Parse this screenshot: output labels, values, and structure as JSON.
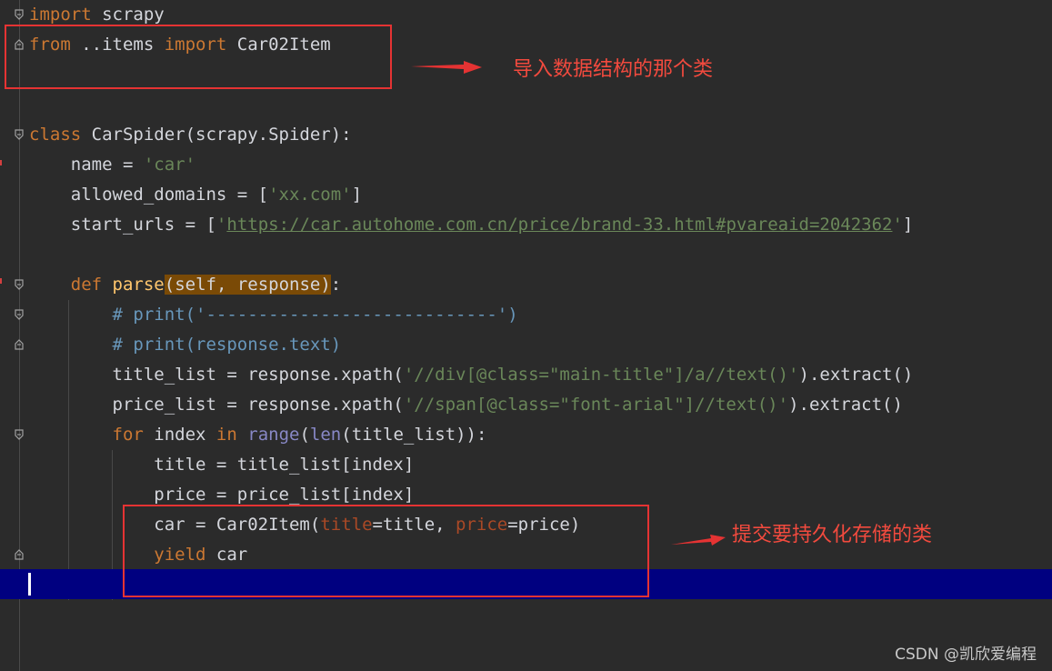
{
  "code": {
    "l1": {
      "kw_import": "import",
      "module": " scrapy"
    },
    "l2": {
      "kw_from": "from",
      "path": " ..items ",
      "kw_import": "import",
      "name": " Car02Item"
    },
    "l5": {
      "kw_class": "class",
      "name": " CarSpider(scrapy.Spider):"
    },
    "l6": {
      "indent": "    ",
      "attr": "name = ",
      "value": "'car'"
    },
    "l7": {
      "indent": "    ",
      "attr": "allowed_domains = [",
      "value": "'xx.com'",
      "close": "]"
    },
    "l8": {
      "indent": "    ",
      "attr": "start_urls = [",
      "q1": "'",
      "url": "https://car.autohome.com.cn/price/brand-33.html#pvareaid=2042362",
      "q2": "'",
      "close": "]"
    },
    "l10": {
      "indent": "    ",
      "kw_def": "def",
      "sp": " ",
      "fn": "parse",
      "args": "(self, response)",
      "end": ":"
    },
    "l11": {
      "indent": "        ",
      "comment": "# print('----------------------------')"
    },
    "l12": {
      "indent": "        ",
      "comment": "# print(response.text)"
    },
    "l13": {
      "indent": "        ",
      "pre": "title_list = response.xpath(",
      "str": "'//div[@class=\"main-title\"]/a//text()'",
      "post": ").extract()"
    },
    "l14": {
      "indent": "        ",
      "pre": "price_list = response.xpath(",
      "str": "'//span[@class=\"font-arial\"]//text()'",
      "post": ").extract()"
    },
    "l15": {
      "indent": "        ",
      "kw_for": "for",
      "mid": " index ",
      "kw_in": "in",
      "sp": " ",
      "range": "range",
      "p1": "(",
      "len": "len",
      "rest": "(title_list)):"
    },
    "l16": {
      "indent": "            ",
      "text": "title = title_list[index]"
    },
    "l17": {
      "indent": "            ",
      "text": "price = price_list[index]"
    },
    "l18": {
      "indent": "            ",
      "pre": "car = Car02Item(",
      "p1": "title",
      "m1": "=title, ",
      "p2": "price",
      "m2": "=price)"
    },
    "l19": {
      "indent": "            ",
      "kw_yield": "yield",
      "rest": " car"
    }
  },
  "annotations": {
    "import_note": "导入数据结构的那个类",
    "yield_note": "提交要持久化存储的类"
  },
  "watermark": "CSDN @凯欣爱编程",
  "colors": {
    "background": "#2b2b2b",
    "keyword": "#cc7832",
    "string": "#6a8759",
    "comment": "#6897bb",
    "annotation": "#e53333",
    "current_line": "#000080"
  }
}
